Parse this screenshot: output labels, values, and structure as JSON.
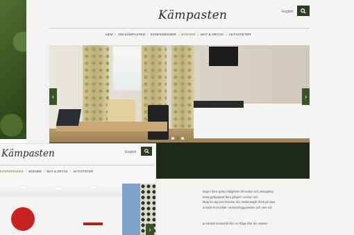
{
  "main_page": {
    "logo": "Kämpasten",
    "lang_link": "English",
    "nav": [
      "Hem",
      "Om Kämpasten",
      "Konferenser",
      "Boende",
      "Mat & Dryck",
      "Aktiviteter"
    ],
    "active_nav_index": 4,
    "slider": {
      "dot_count": 3,
      "active_dot_index": 1
    },
    "body_lines": [
      "degen finns goda möjligheter till motion och avkoppling",
      "testa gympapass flera gånger i veckan och",
      "bkap för dig som föredrar det. Motionsspår finns på nära",
      "is basis finns både i motionsbygganaden och nere vid",
      "",
      "",
      "pt särskilt önskemål eller en fråga inför din vistelse"
    ]
  },
  "front_page": {
    "logo": "Kämpasten",
    "lang_link": "English",
    "nav": [
      "Konferenser",
      "Boende",
      "Mat & Dryck",
      "Aktiviteter"
    ],
    "active_nav_index": 0
  },
  "colors": {
    "accent_green": "#2c3b22",
    "active_nav": "#5e7a3e",
    "dark_band": "#1f2a1b"
  },
  "icons": {
    "search": "search-icon",
    "prev": "chevron-left-icon",
    "next": "chevron-right-icon"
  }
}
